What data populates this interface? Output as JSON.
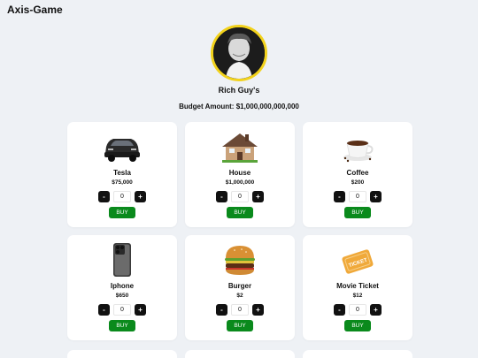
{
  "app": {
    "title": "Axis-Game"
  },
  "profile": {
    "name": "Rich Guy's",
    "budget_label": "Budget Amount: $1,000,000,000,000"
  },
  "products": [
    {
      "name": "Tesla",
      "price": "$75,000",
      "qty": "0",
      "minus": "-",
      "plus": "+",
      "buy": "BUY",
      "icon": "car-icon"
    },
    {
      "name": "House",
      "price": "$1,000,000",
      "qty": "0",
      "minus": "-",
      "plus": "+",
      "buy": "BUY",
      "icon": "house-icon"
    },
    {
      "name": "Coffee",
      "price": "$200",
      "qty": "0",
      "minus": "-",
      "plus": "+",
      "buy": "BUY",
      "icon": "coffee-icon"
    },
    {
      "name": "Iphone",
      "price": "$650",
      "qty": "0",
      "minus": "-",
      "plus": "+",
      "buy": "BUY",
      "icon": "phone-icon"
    },
    {
      "name": "Burger",
      "price": "$2",
      "qty": "0",
      "minus": "-",
      "plus": "+",
      "buy": "BUY",
      "icon": "burger-icon"
    },
    {
      "name": "Movie Ticket",
      "price": "$12",
      "qty": "0",
      "minus": "-",
      "plus": "+",
      "buy": "BUY",
      "icon": "ticket-icon",
      "ticket_text": "TICKET"
    }
  ],
  "colors": {
    "buy": "#0a8a1c",
    "avatar_border": "#f2d21b",
    "background": "#eef1f5"
  }
}
